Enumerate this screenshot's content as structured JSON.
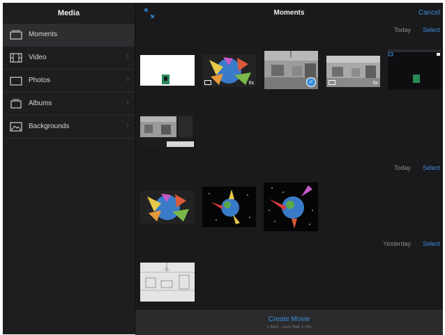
{
  "sidebar": {
    "title": "Media",
    "items": [
      {
        "label": "Moments",
        "icon": "moments-icon",
        "chevron": ""
      },
      {
        "label": "Video",
        "icon": "film-icon",
        "chevron": "›"
      },
      {
        "label": "Photos",
        "icon": "photo-icon",
        "chevron": "›"
      },
      {
        "label": "Albums",
        "icon": "album-icon",
        "chevron": "›"
      },
      {
        "label": "Backgrounds",
        "icon": "background-icon",
        "chevron": "›"
      }
    ]
  },
  "header": {
    "title": "Moments",
    "cancel_label": "Cancel"
  },
  "sections": [
    {
      "date": "Today",
      "select_label": "Select"
    },
    {
      "date": "Today",
      "select_label": "Select"
    },
    {
      "date": "Yesterday",
      "select_label": "Select"
    }
  ],
  "thumbnails": {
    "video_badge": "6s",
    "video_badge_2": "6s",
    "checkmark": "✓"
  },
  "footer": {
    "create_label": "Create Movie",
    "sub_label": "1 Item - Less than 1 min"
  },
  "colors": {
    "accent": "#3a8fdc",
    "background": "#1a1a1c",
    "sidebar": "#1e1e20"
  }
}
